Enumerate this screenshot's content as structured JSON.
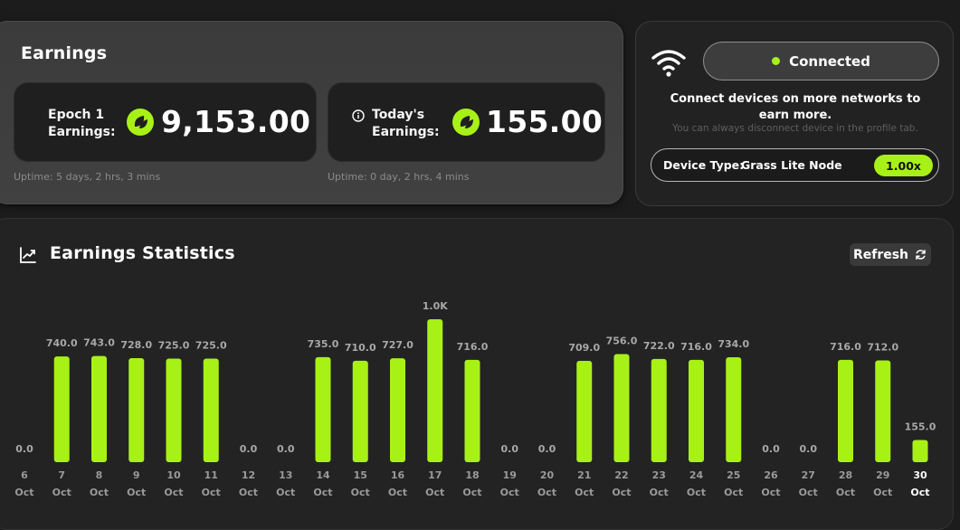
{
  "earnings": {
    "title": "Earnings",
    "epoch_card": {
      "label_line1": "Epoch 1",
      "label_line2": "Earnings:",
      "value": "9,153.00",
      "icon": "leaf-icon",
      "uptime": "Uptime: 5 days, 2 hrs, 3 mins"
    },
    "today_card": {
      "label_line1": "Today's",
      "label_line2": "Earnings:",
      "value": "155.00",
      "icon": "leaf-icon",
      "info_icon": "info-icon",
      "uptime": "Uptime: 0 day, 2 hrs, 4 mins"
    }
  },
  "device": {
    "wifi_icon": "wifi-icon",
    "status": "Connected",
    "status_color": "#a8f116",
    "message": "Connect devices on more networks to earn more.",
    "sub_message": "You can always disconnect device in the profile tab.",
    "device_type_label": "Device Type:",
    "device_type_value": "Grass Lite Node",
    "multiplier": "1.00x"
  },
  "stats": {
    "title": "Earnings Statistics",
    "title_icon": "trending-up-icon",
    "refresh_label": "Refresh",
    "refresh_icon": "refresh-icon"
  },
  "chart_data": {
    "type": "bar",
    "accent_color": "#a8f116",
    "categories": [
      "6 Oct",
      "7 Oct",
      "8 Oct",
      "9 Oct",
      "10 Oct",
      "11 Oct",
      "12 Oct",
      "13 Oct",
      "14 Oct",
      "15 Oct",
      "16 Oct",
      "17 Oct",
      "18 Oct",
      "19 Oct",
      "20 Oct",
      "21 Oct",
      "22 Oct",
      "23 Oct",
      "24 Oct",
      "25 Oct",
      "26 Oct",
      "27 Oct",
      "28 Oct",
      "29 Oct",
      "30 Oct"
    ],
    "days": [
      "6",
      "7",
      "8",
      "9",
      "10",
      "11",
      "12",
      "13",
      "14",
      "15",
      "16",
      "17",
      "18",
      "19",
      "20",
      "21",
      "22",
      "23",
      "24",
      "25",
      "26",
      "27",
      "28",
      "29",
      "30"
    ],
    "month": "Oct",
    "values": [
      0,
      740,
      743,
      728,
      725,
      725,
      0,
      0,
      735,
      710,
      727,
      1000,
      716,
      0,
      0,
      709,
      756,
      722,
      716,
      734,
      0,
      0,
      716,
      712,
      155
    ],
    "value_labels": [
      "0.0",
      "740.0",
      "743.0",
      "728.0",
      "725.0",
      "725.0",
      "0.0",
      "0.0",
      "735.0",
      "710.0",
      "727.0",
      "1.0K",
      "716.0",
      "0.0",
      "0.0",
      "709.0",
      "756.0",
      "722.0",
      "716.0",
      "734.0",
      "0.0",
      "0.0",
      "716.0",
      "712.0",
      "155.0"
    ],
    "highlight_index": 24
  }
}
